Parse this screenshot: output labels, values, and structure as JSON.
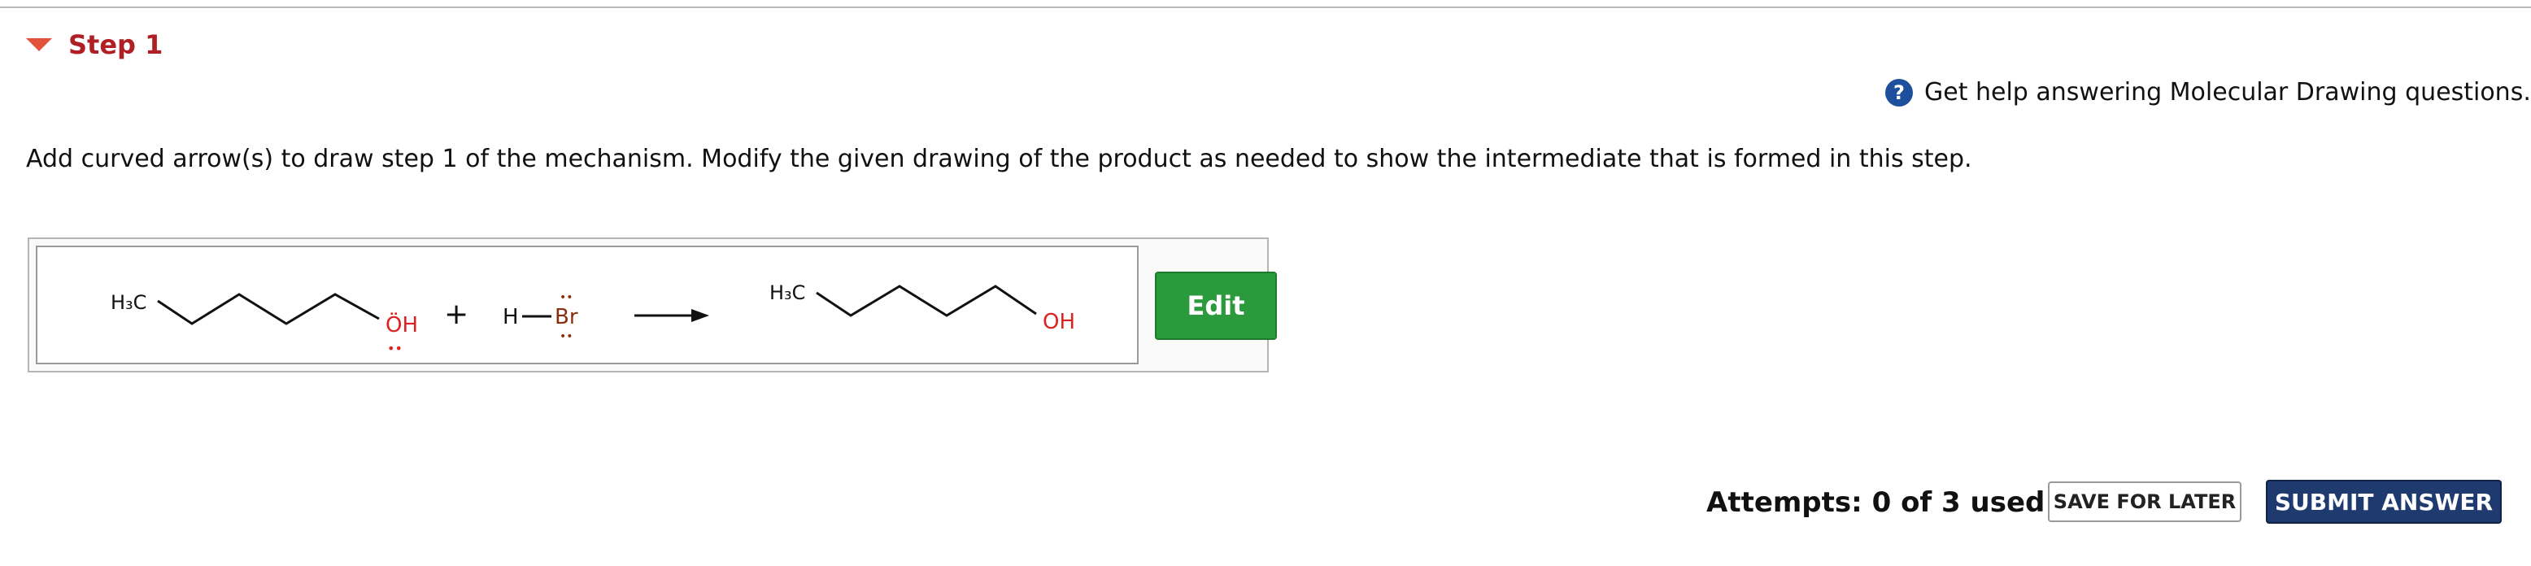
{
  "step": {
    "title": "Step 1"
  },
  "help": {
    "icon": "question-icon",
    "icon_glyph": "?",
    "text": "Get help answering Molecular Drawing questions."
  },
  "instructions": "Add curved arrow(s) to draw step 1 of the mechanism. Modify the given drawing of the product as needed to show the intermediate that is formed in this step.",
  "drawing": {
    "reactant1": {
      "methyl": "H₃C",
      "oh_label": "ÖH",
      "oh_lone_pair": "••"
    },
    "plus": "+",
    "reactant2": {
      "h": "H",
      "br": "Br",
      "lone_pairs": "••"
    },
    "product": {
      "methyl": "H₃C",
      "oh_label": "OH"
    }
  },
  "edit_button": "Edit",
  "attempts": "Attempts: 0 of 3 used",
  "save_button": "SAVE FOR LATER",
  "submit_button": "SUBMIT ANSWER",
  "colors": {
    "accent": "#b01f24",
    "oxygen": "#d22",
    "bromine": "#8a2d10",
    "edit": "#2b9a3c",
    "submit": "#1e3a6e"
  }
}
